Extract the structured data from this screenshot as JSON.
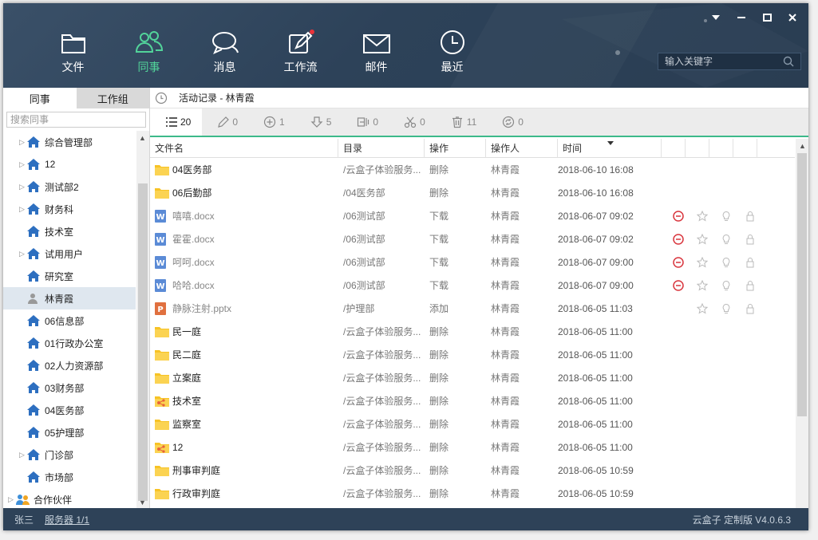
{
  "nav": [
    {
      "label": "文件",
      "icon": "folder-icon",
      "active": false
    },
    {
      "label": "同事",
      "icon": "colleagues-icon",
      "active": true
    },
    {
      "label": "消息",
      "icon": "message-icon",
      "active": false
    },
    {
      "label": "工作流",
      "icon": "workflow-icon",
      "active": false
    },
    {
      "label": "邮件",
      "icon": "mail-icon",
      "active": false
    },
    {
      "label": "最近",
      "icon": "clock-icon",
      "active": false
    }
  ],
  "search": {
    "placeholder": "输入关键字"
  },
  "left": {
    "tabs": [
      "同事",
      "工作组"
    ],
    "search_placeholder": "搜索同事",
    "tree": [
      {
        "label": "综合管理部",
        "expandable": true,
        "type": "dept"
      },
      {
        "label": "12",
        "expandable": true,
        "type": "dept"
      },
      {
        "label": "测试部2",
        "expandable": true,
        "type": "dept"
      },
      {
        "label": "财务科",
        "expandable": true,
        "type": "dept"
      },
      {
        "label": "技术室",
        "expandable": false,
        "type": "dept"
      },
      {
        "label": "试用用户",
        "expandable": true,
        "type": "dept"
      },
      {
        "label": "研究室",
        "expandable": false,
        "type": "dept"
      },
      {
        "label": "林青霞",
        "expandable": false,
        "type": "user",
        "selected": true
      },
      {
        "label": "06信息部",
        "expandable": false,
        "type": "dept"
      },
      {
        "label": "01行政办公室",
        "expandable": false,
        "type": "dept"
      },
      {
        "label": "02人力资源部",
        "expandable": false,
        "type": "dept"
      },
      {
        "label": "03财务部",
        "expandable": false,
        "type": "dept"
      },
      {
        "label": "04医务部",
        "expandable": false,
        "type": "dept"
      },
      {
        "label": "05护理部",
        "expandable": false,
        "type": "dept"
      },
      {
        "label": "门诊部",
        "expandable": true,
        "type": "dept"
      },
      {
        "label": "市场部",
        "expandable": false,
        "type": "dept"
      },
      {
        "label": "合作伙伴",
        "expandable": true,
        "type": "partner"
      }
    ]
  },
  "breadcrumb": "活动记录 - 林青霞",
  "filters": [
    {
      "icon": "list-icon",
      "count": "20",
      "selected": true
    },
    {
      "icon": "edit-icon",
      "count": "0"
    },
    {
      "icon": "add-circle-icon",
      "count": "1"
    },
    {
      "icon": "download-icon",
      "count": "5"
    },
    {
      "icon": "move-icon",
      "count": "0"
    },
    {
      "icon": "cut-icon",
      "count": "0"
    },
    {
      "icon": "trash-icon",
      "count": "11"
    },
    {
      "icon": "restore-icon",
      "count": "0"
    }
  ],
  "columns": [
    "文件名",
    "目录",
    "操作",
    "操作人",
    "时间"
  ],
  "rows": [
    {
      "name": "04医务部",
      "type": "folder",
      "dir": "/云盒子体验服务...",
      "op": "删除",
      "user": "林青霞",
      "time": "2018-06-10 16:08",
      "actions": false
    },
    {
      "name": "06后勤部",
      "type": "folder",
      "dir": "/04医务部",
      "op": "删除",
      "user": "林青霞",
      "time": "2018-06-10 16:08",
      "actions": false
    },
    {
      "name": "嘻嘻.docx",
      "type": "word",
      "dir": "/06测试部",
      "op": "下载",
      "user": "林青霞",
      "time": "2018-06-07 09:02",
      "actions": true
    },
    {
      "name": "霍霍.docx",
      "type": "word",
      "dir": "/06测试部",
      "op": "下载",
      "user": "林青霞",
      "time": "2018-06-07 09:02",
      "actions": true
    },
    {
      "name": "呵呵.docx",
      "type": "word",
      "dir": "/06测试部",
      "op": "下载",
      "user": "林青霞",
      "time": "2018-06-07 09:00",
      "actions": true
    },
    {
      "name": "哈哈.docx",
      "type": "word",
      "dir": "/06测试部",
      "op": "下载",
      "user": "林青霞",
      "time": "2018-06-07 09:00",
      "actions": true
    },
    {
      "name": "静脉注射.pptx",
      "type": "ppt",
      "dir": "/护理部",
      "op": "添加",
      "user": "林青霞",
      "time": "2018-06-05 11:03",
      "actions": "noremove"
    },
    {
      "name": "民一庭",
      "type": "folder",
      "dir": "/云盒子体验服务...",
      "op": "删除",
      "user": "林青霞",
      "time": "2018-06-05 11:00",
      "actions": false
    },
    {
      "name": "民二庭",
      "type": "folder",
      "dir": "/云盒子体验服务...",
      "op": "删除",
      "user": "林青霞",
      "time": "2018-06-05 11:00",
      "actions": false
    },
    {
      "name": "立案庭",
      "type": "folder",
      "dir": "/云盒子体验服务...",
      "op": "删除",
      "user": "林青霞",
      "time": "2018-06-05 11:00",
      "actions": false
    },
    {
      "name": "技术室",
      "type": "shared",
      "dir": "/云盒子体验服务...",
      "op": "删除",
      "user": "林青霞",
      "time": "2018-06-05 11:00",
      "actions": false
    },
    {
      "name": "监察室",
      "type": "folder",
      "dir": "/云盒子体验服务...",
      "op": "删除",
      "user": "林青霞",
      "time": "2018-06-05 11:00",
      "actions": false
    },
    {
      "name": "12",
      "type": "shared",
      "dir": "/云盒子体验服务...",
      "op": "删除",
      "user": "林青霞",
      "time": "2018-06-05 11:00",
      "actions": false
    },
    {
      "name": "刑事审判庭",
      "type": "folder",
      "dir": "/云盒子体验服务...",
      "op": "删除",
      "user": "林青霞",
      "time": "2018-06-05 10:59",
      "actions": false
    },
    {
      "name": "行政审判庭",
      "type": "folder",
      "dir": "/云盒子体验服务...",
      "op": "删除",
      "user": "林青霞",
      "time": "2018-06-05 10:59",
      "actions": false
    }
  ],
  "status": {
    "user": "张三",
    "server": "服务器 1/1",
    "version": "云盒子 定制版 V4.0.6.3"
  },
  "colors": {
    "header": "#2d4259",
    "accent": "#52d49a",
    "folder": "#f7c325",
    "word": "#4b7cc9",
    "ppt": "#d9623b",
    "remove": "#d9363e"
  }
}
